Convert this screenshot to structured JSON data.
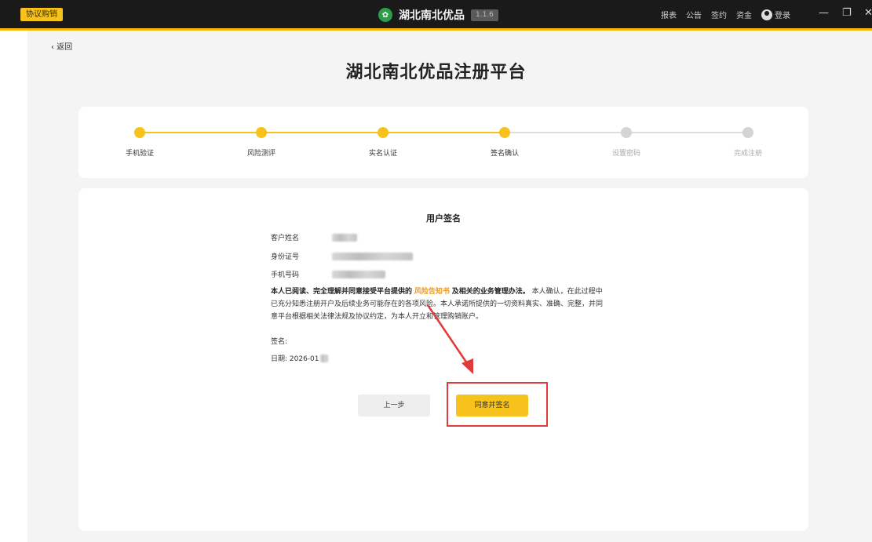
{
  "topbar": {
    "tag_label": "协议购销",
    "app_title": "湖北南北优品",
    "version": "1.1.6",
    "menu": [
      "报表",
      "公告",
      "签约",
      "资金"
    ],
    "login_label": "登录",
    "logo_icon": "leaf-logo-icon",
    "accent_color": "#f7c21c"
  },
  "nav": {
    "back_label": "‹ 返回"
  },
  "page_title": "湖北南北优品注册平台",
  "steps": [
    {
      "label": "手机验证",
      "status": "done"
    },
    {
      "label": "风险测评",
      "status": "done"
    },
    {
      "label": "实名认证",
      "status": "done"
    },
    {
      "label": "签名确认",
      "status": "done"
    },
    {
      "label": "设置密码",
      "status": "todo"
    },
    {
      "label": "完成注册",
      "status": "todo"
    }
  ],
  "form": {
    "title": "用户签名",
    "fields": {
      "name_label": "客户姓名",
      "id_label": "身份证号",
      "phone_label": "手机号码"
    },
    "statement": {
      "part1": "本人已阅读、完全理解并同意接受平台提供的",
      "link": "风险告知书",
      "part2": "及相关的业务管理办法。",
      "part3": "本人确认，在此过程中已充分知悉注册开户及后续业务可能存在的各项风险。本人承诺所提供的一切资料真实、准确、完整，并同意平台根据相关法律法规及协议约定，为本人开立和管理购销账户。"
    },
    "sign_label": "签名:",
    "date_label": "日期: 2026-01",
    "prev_button": "上一步",
    "agree_button": "同意并签名"
  }
}
